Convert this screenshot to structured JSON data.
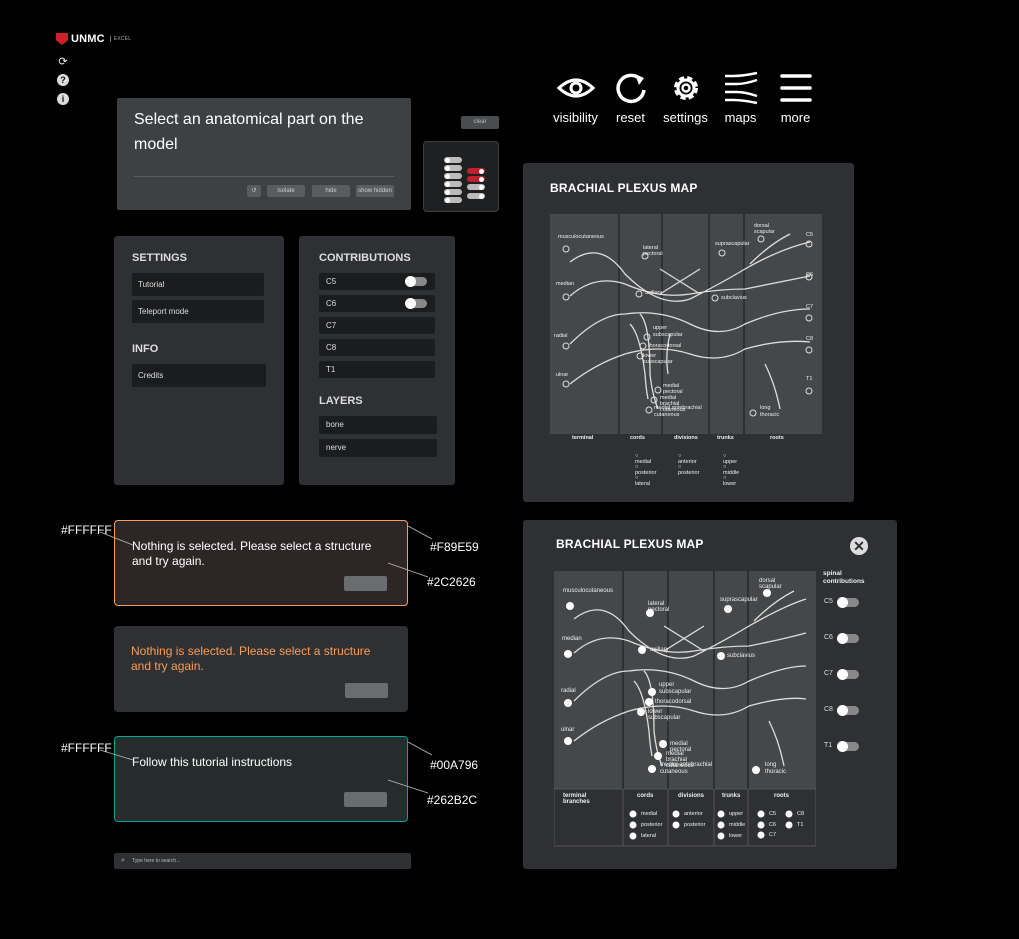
{
  "logo": {
    "text": "UNMC",
    "sub": "EXCEL"
  },
  "sidebar_icons": [
    "refresh-icon",
    "help-icon",
    "info-icon"
  ],
  "topnav": [
    {
      "label": "visibility",
      "icon": "eye-icon"
    },
    {
      "label": "reset",
      "icon": "reset-icon"
    },
    {
      "label": "settings",
      "icon": "gear-icon"
    },
    {
      "label": "maps",
      "icon": "maps-icon"
    },
    {
      "label": "more",
      "icon": "menu-icon"
    }
  ],
  "prompt": {
    "title": "Select an anatomical part on the model",
    "buttons": {
      "undo": "↺",
      "isolate": "isolate",
      "hide": "hide",
      "show_hidden": "show hidden"
    }
  },
  "clear_label": "clear",
  "settings_panel": {
    "settings_title": "SETTINGS",
    "settings_items": [
      "Tutorial",
      "Teleport mode"
    ],
    "info_title": "INFO",
    "info_items": [
      "Credits"
    ]
  },
  "contributions_panel": {
    "title": "CONTRIBUTIONS",
    "items": [
      "C5",
      "C6",
      "C7",
      "C8",
      "T1"
    ],
    "layers_title": "LAYERS",
    "layers": [
      "bone",
      "nerve"
    ]
  },
  "messages": {
    "error1": "Nothing is selected. Please select a structure and try again.",
    "error2": "Nothing is selected. Please select a structure and try again.",
    "tutorial": "Follow this tutorial instructions"
  },
  "annotations": {
    "white1": "#FFFFFF",
    "border1": "#F89E59",
    "bg1": "#2C2626",
    "white2": "#FFFFFF",
    "border2": "#00A796",
    "bg2": "#262B2C"
  },
  "colors": {
    "orange": "#F89E59",
    "teal": "#00A796",
    "error_bg": "#2C2626",
    "tutorial_bg": "#262B2C",
    "panel": "#2E3033",
    "red_toggle": "#C0202A"
  },
  "map_small": {
    "title": "BRACHIAL PLEXUS MAP",
    "labels": {
      "musculocutaneous": "musculocutaneous",
      "lateral_pectoral": "lateral pectoral",
      "suprascapular": "suprascapular",
      "dorsal_scapular": "dorsal scapular",
      "c5": "C5",
      "c6": "C6",
      "c7": "C7",
      "c8": "C8",
      "t1": "T1",
      "median": "median",
      "axillary": "axillary",
      "subclavius": "subclavius",
      "radial": "radial",
      "upper_subscapular": "upper subscapular",
      "thoracodorsal": "thoracodorsal",
      "lower_subscapular": "lower subscapular",
      "ulnar": "ulnar",
      "medial_pectoral": "medial pectoral",
      "medial_brachial": "medial brachial cutaneous",
      "medial_antebrachial": "medial antebrachial cutaneous",
      "long_thoracic": "long thoracic"
    },
    "columns": [
      "terminal",
      "cords",
      "divisions",
      "trunks",
      "roots"
    ],
    "cords": [
      "medial",
      "posterior",
      "lateral"
    ],
    "divisions": [
      "anterior",
      "posterior"
    ],
    "trunks": [
      "upper",
      "middle",
      "lower"
    ]
  },
  "map_large": {
    "title": "BRACHIAL PLEXUS MAP",
    "close": "✕",
    "labels": {
      "musculocutaneous": "musculocutaneous",
      "lateral_pectoral": "lateral pectoral",
      "suprascapular": "suprascapular",
      "dorsal_scapular": "dorsal scapular",
      "median": "median",
      "axillary": "axillary",
      "subclavius": "subclavius",
      "radial": "radial",
      "upper_subscapular": "upper subscapular",
      "thoracodorsal": "thoracodorsal",
      "lower_subscapular": "lower subscapular",
      "ulnar": "ulnar",
      "medial_pectoral": "medial pectoral",
      "medial_brachial": "medial brachial cutaneous",
      "medial_antebrachial": "medial antebrachial cutaneous",
      "long_thoracic": "long thoracic"
    },
    "columns": [
      "terminal branches",
      "cords",
      "divisions",
      "trunks",
      "roots"
    ],
    "cords": [
      "medial",
      "posterior",
      "lateral"
    ],
    "divisions": [
      "anterior",
      "posterior"
    ],
    "trunks": [
      "upper",
      "middle",
      "lower"
    ],
    "roots": [
      "C5",
      "C8",
      "C6",
      "T1",
      "C7"
    ],
    "spinal_title": "spinal contributions",
    "spinal": [
      "C5",
      "C6",
      "C7",
      "C8",
      "T1"
    ]
  },
  "search": {
    "placeholder": "Type here to search..."
  }
}
